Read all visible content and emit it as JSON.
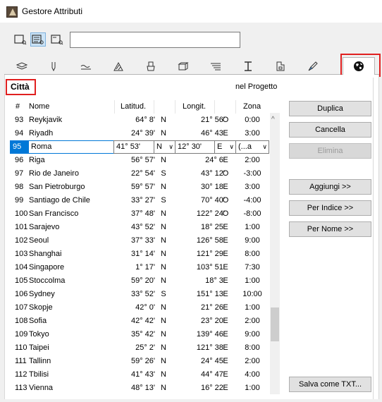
{
  "window": {
    "title": "Gestore Attributi"
  },
  "search": {
    "value": ""
  },
  "section": {
    "title": "Città",
    "subtitle": "nel Progetto"
  },
  "columns": {
    "num": "#",
    "name": "Nome",
    "lat": "Latitud.",
    "lon": "Longit.",
    "zone": "Zona"
  },
  "rows": [
    {
      "num": "93",
      "name": "Reykjavik",
      "lat": "64° 8'",
      "ns": "N",
      "lon": "21° 56'",
      "ew": "O",
      "zone": "0:00"
    },
    {
      "num": "94",
      "name": "Riyadh",
      "lat": "24° 39'",
      "ns": "N",
      "lon": "46° 43'",
      "ew": "E",
      "zone": "3:00"
    },
    {
      "num": "95",
      "name": "Roma",
      "lat": "41° 53'",
      "ns": "N",
      "lon": "12° 30'",
      "ew": "E",
      "zone": "(...a"
    },
    {
      "num": "96",
      "name": "Riga",
      "lat": "56° 57'",
      "ns": "N",
      "lon": "24° 6'",
      "ew": "E",
      "zone": "2:00"
    },
    {
      "num": "97",
      "name": "Rio de Janeiro",
      "lat": "22° 54'",
      "ns": "S",
      "lon": "43° 12'",
      "ew": "O",
      "zone": "-3:00"
    },
    {
      "num": "98",
      "name": "San Pietroburgo",
      "lat": "59° 57'",
      "ns": "N",
      "lon": "30° 18'",
      "ew": "E",
      "zone": "3:00"
    },
    {
      "num": "99",
      "name": "Santiago de Chile",
      "lat": "33° 27'",
      "ns": "S",
      "lon": "70° 40'",
      "ew": "O",
      "zone": "-4:00"
    },
    {
      "num": "100",
      "name": "San Francisco",
      "lat": "37° 48'",
      "ns": "N",
      "lon": "122° 24'",
      "ew": "O",
      "zone": "-8:00"
    },
    {
      "num": "101",
      "name": "Sarajevo",
      "lat": "43° 52'",
      "ns": "N",
      "lon": "18° 25'",
      "ew": "E",
      "zone": "1:00"
    },
    {
      "num": "102",
      "name": "Seoul",
      "lat": "37° 33'",
      "ns": "N",
      "lon": "126° 58'",
      "ew": "E",
      "zone": "9:00"
    },
    {
      "num": "103",
      "name": "Shanghai",
      "lat": "31° 14'",
      "ns": "N",
      "lon": "121° 29'",
      "ew": "E",
      "zone": "8:00"
    },
    {
      "num": "104",
      "name": "Singapore",
      "lat": "1° 17'",
      "ns": "N",
      "lon": "103° 51'",
      "ew": "E",
      "zone": "7:30"
    },
    {
      "num": "105",
      "name": "Stoccolma",
      "lat": "59° 20'",
      "ns": "N",
      "lon": "18° 3'",
      "ew": "E",
      "zone": "1:00"
    },
    {
      "num": "106",
      "name": "Sydney",
      "lat": "33° 52'",
      "ns": "S",
      "lon": "151° 13'",
      "ew": "E",
      "zone": "10:00"
    },
    {
      "num": "107",
      "name": "Skopje",
      "lat": "42° 0'",
      "ns": "N",
      "lon": "21° 26'",
      "ew": "E",
      "zone": "1:00"
    },
    {
      "num": "108",
      "name": "Sofia",
      "lat": "42° 42'",
      "ns": "N",
      "lon": "23° 20'",
      "ew": "E",
      "zone": "2:00"
    },
    {
      "num": "109",
      "name": "Tokyo",
      "lat": "35° 42'",
      "ns": "N",
      "lon": "139° 46'",
      "ew": "E",
      "zone": "9:00"
    },
    {
      "num": "110",
      "name": "Taipei",
      "lat": "25° 2'",
      "ns": "N",
      "lon": "121° 38'",
      "ew": "E",
      "zone": "8:00"
    },
    {
      "num": "111",
      "name": "Tallinn",
      "lat": "59° 26'",
      "ns": "N",
      "lon": "24° 45'",
      "ew": "E",
      "zone": "2:00"
    },
    {
      "num": "112",
      "name": "Tbilisi",
      "lat": "41° 43'",
      "ns": "N",
      "lon": "44° 47'",
      "ew": "E",
      "zone": "4:00"
    },
    {
      "num": "113",
      "name": "Vienna",
      "lat": "48° 13'",
      "ns": "N",
      "lon": "16° 22'",
      "ew": "E",
      "zone": "1:00"
    }
  ],
  "buttons": {
    "duplica": "Duplica",
    "cancella": "Cancella",
    "elimina": "Elimina",
    "aggiungi": "Aggiungi >>",
    "per_indice": "Per Indice >>",
    "per_nome": "Per Nome >>",
    "salva": "Salva come TXT..."
  },
  "icons": [
    "list-view-icon",
    "detail-view-icon",
    "preview-view-icon",
    "layers-icon",
    "pen-icon",
    "line-icon",
    "fill-icon",
    "paint-icon",
    "composite-icon",
    "profile-icon",
    "column-icon",
    "zone-icon",
    "brush-icon",
    "globe-icon"
  ]
}
